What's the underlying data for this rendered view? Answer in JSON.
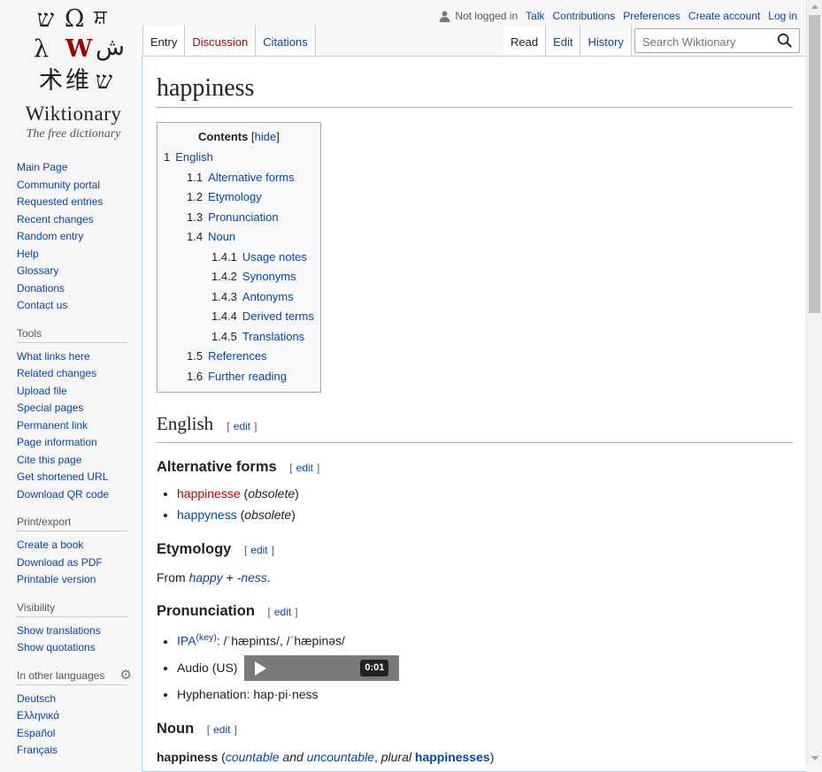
{
  "logo": {
    "glyphs": [
      "ש",
      "Ω",
      "ਸ਼",
      "λ",
      "W",
      "ش",
      "术",
      "维",
      "ש"
    ],
    "wordmark": "Wiktionary",
    "tagline": "The free dictionary"
  },
  "personal": {
    "status": "Not logged in",
    "links": [
      "Talk",
      "Contributions",
      "Preferences",
      "Create account",
      "Log in"
    ]
  },
  "tabs": {
    "left": [
      "Entry",
      "Discussion",
      "Citations"
    ],
    "right": [
      "Read",
      "Edit",
      "History"
    ]
  },
  "search": {
    "placeholder": "Search Wiktionary"
  },
  "sidebar": {
    "navigation": [
      "Main Page",
      "Community portal",
      "Requested entries",
      "Recent changes",
      "Random entry",
      "Help",
      "Glossary",
      "Donations",
      "Contact us"
    ],
    "tools": {
      "heading": "Tools",
      "items": [
        "What links here",
        "Related changes",
        "Upload file",
        "Special pages",
        "Permanent link",
        "Page information",
        "Cite this page",
        "Get shortened URL",
        "Download QR code"
      ]
    },
    "print": {
      "heading": "Print/export",
      "items": [
        "Create a book",
        "Download as PDF",
        "Printable version"
      ]
    },
    "visibility": {
      "heading": "Visibility",
      "items": [
        "Show translations",
        "Show quotations"
      ]
    },
    "languages": {
      "heading": "In other languages",
      "items": [
        "Deutsch",
        "Ελληνικά",
        "Español",
        "Français"
      ]
    }
  },
  "page": {
    "title": "happiness",
    "toc": {
      "title": "Contents",
      "hide": "hide",
      "entries": [
        {
          "num": "1",
          "label": "English",
          "level": 1
        },
        {
          "num": "1.1",
          "label": "Alternative forms",
          "level": 2
        },
        {
          "num": "1.2",
          "label": "Etymology",
          "level": 2
        },
        {
          "num": "1.3",
          "label": "Pronunciation",
          "level": 2
        },
        {
          "num": "1.4",
          "label": "Noun",
          "level": 2
        },
        {
          "num": "1.4.1",
          "label": "Usage notes",
          "level": 3
        },
        {
          "num": "1.4.2",
          "label": "Synonyms",
          "level": 3
        },
        {
          "num": "1.4.3",
          "label": "Antonyms",
          "level": 3
        },
        {
          "num": "1.4.4",
          "label": "Derived terms",
          "level": 3
        },
        {
          "num": "1.4.5",
          "label": "Translations",
          "level": 3
        },
        {
          "num": "1.5",
          "label": "References",
          "level": 2
        },
        {
          "num": "1.6",
          "label": "Further reading",
          "level": 2
        }
      ]
    },
    "edit_label": "edit",
    "english": {
      "heading": "English"
    },
    "alt_forms": {
      "heading": "Alternative forms",
      "items": [
        {
          "word": "happinesse",
          "note": "obsolete",
          "red": true
        },
        {
          "word": "happyness",
          "note": "obsolete",
          "red": false
        }
      ]
    },
    "etymology": {
      "heading": "Etymology",
      "from": "From",
      "w1": "happy",
      "plus": "+",
      "w2": "-ness",
      "end": "."
    },
    "pronunciation": {
      "heading": "Pronunciation",
      "ipa_label": "IPA",
      "ipa_key": "(key)",
      "ipa_value": ": /ˈhæpinɪs/, /ˈhæpinəs/",
      "audio_label": "Audio (US)",
      "audio_time": "0:01",
      "hyphenation": "Hyphenation: hap·pi·ness"
    },
    "noun": {
      "heading": "Noun",
      "headword": "happiness",
      "open": "(",
      "countable": "countable",
      "and": "and",
      "uncountable": "uncountable",
      "plural_label": "plural",
      "plural": "happinesses",
      "close": ")"
    }
  },
  "colors": {
    "link": "#0645ad",
    "redlink": "#ba0000",
    "border": "#a7d7f9"
  }
}
